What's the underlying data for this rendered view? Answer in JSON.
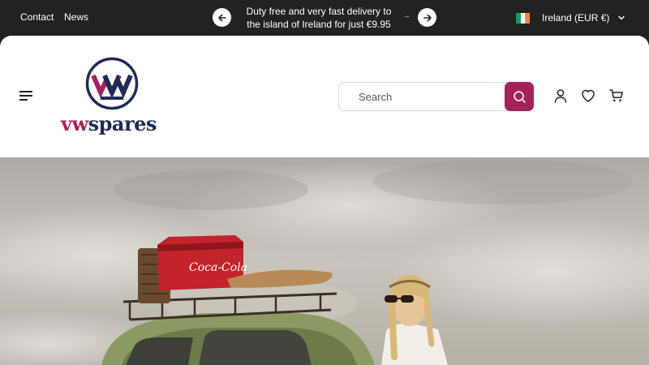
{
  "topbar": {
    "links": [
      {
        "label": "Contact"
      },
      {
        "label": "News"
      }
    ],
    "promo_text": "Duty free and very fast delivery to the island of Ireland for just €9.95",
    "promo_arrow": "→",
    "locale": {
      "label": "Ireland (EUR €)",
      "flag_colors": [
        "#169b62",
        "#ffffff",
        "#ff883e"
      ]
    },
    "icons": {
      "prev": "arrow-left-icon",
      "next": "arrow-right-icon",
      "dropdown": "chevron-down-icon"
    }
  },
  "header": {
    "logo": {
      "brand_part1": "vw",
      "brand_part2": "spares",
      "monogram": "VW"
    },
    "search": {
      "placeholder": "Search"
    },
    "icons": {
      "menu": "menu-icon",
      "search": "search-icon",
      "account": "account-icon",
      "wishlist": "heart-icon",
      "cart": "cart-icon"
    }
  },
  "hero": {
    "cooler_brand": "Coca-Cola"
  },
  "colors": {
    "topbar_bg": "#222222",
    "accent": "#a4245a",
    "navy": "#1f2b55"
  }
}
